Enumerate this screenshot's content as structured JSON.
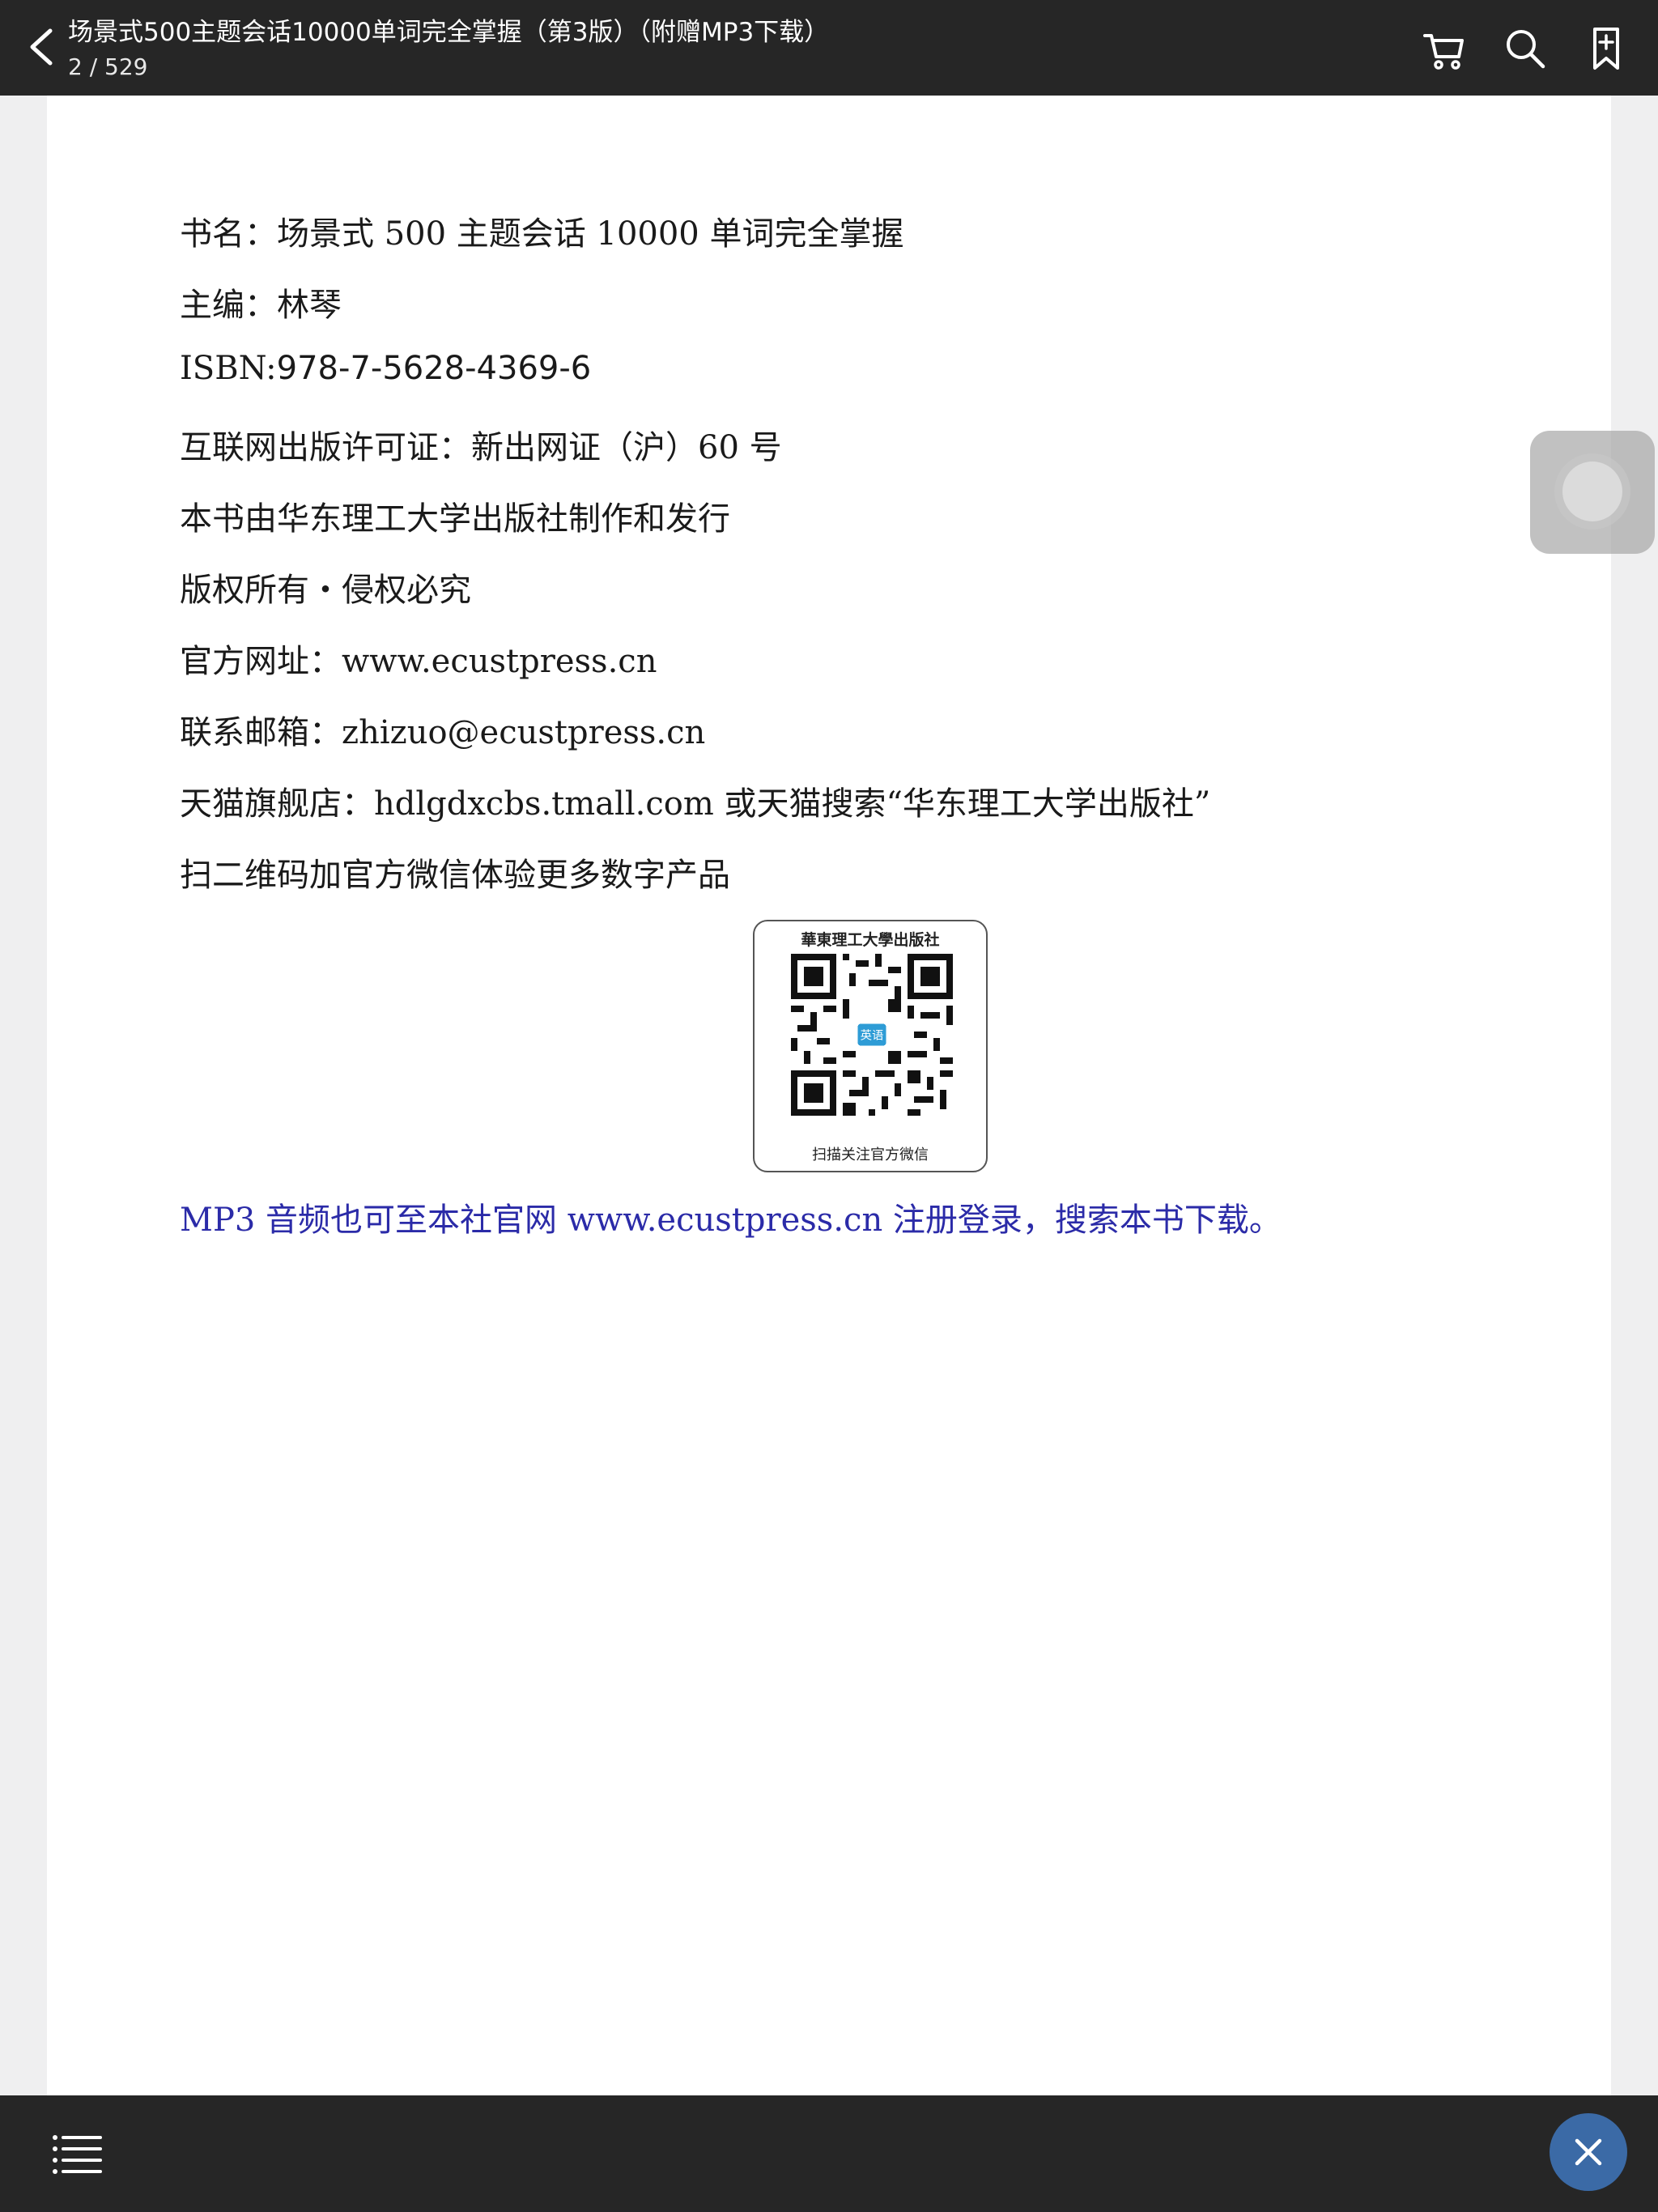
{
  "header": {
    "title": "场景式500主题会话10000单词完全掌握（第3版）（附赠MP3下载）",
    "page_indicator": "2 / 529",
    "icons": [
      "chevron-left-icon",
      "cart-icon",
      "search-icon",
      "bookmark-add-icon"
    ]
  },
  "document": {
    "lines": [
      "书名：场景式 500 主题会话 10000 单词完全掌握",
      "主编：林琴",
      "互联网出版许可证：新出网证（沪）60 号",
      "本书由华东理工大学出版社制作和发行",
      "版权所有・侵权必究",
      "官方网址：www.ecustpress.cn",
      "联系邮箱：zhizuo@ecustpress.cn",
      "天猫旗舰店：hdlgdxcbs.tmall.com 或天猫搜索“华东理工大学出版社”",
      "扫二维码加官方微信体验更多数字产品"
    ],
    "isbn_label": "ISBN:",
    "isbn_value": "978-7-5628-4369-6",
    "qr": {
      "caption_top": "華東理工大學出版社",
      "caption_bottom": "扫描关注官方微信",
      "center_label": "英语"
    },
    "mp3_note": "MP3 音频也可至本社官网 www.ecustpress.cn 注册登录，搜索本书下载。"
  },
  "footer": {
    "icons": [
      "list-icon",
      "close-icon"
    ]
  },
  "colors": {
    "bar": "#262626",
    "link_text": "#2b2ba8",
    "close_button": "#3b6aa6"
  }
}
